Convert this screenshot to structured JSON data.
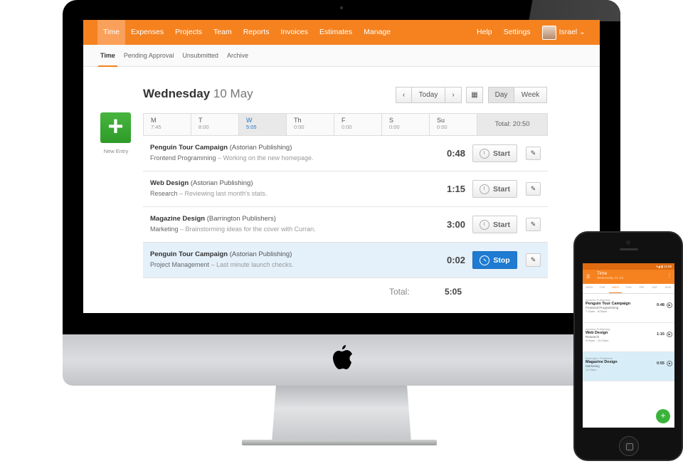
{
  "colors": {
    "brand": "#f5821f",
    "primary": "#1e7bd1",
    "success": "#3bb33a"
  },
  "topnav": {
    "items": [
      "Time",
      "Expenses",
      "Projects",
      "Team",
      "Reports",
      "Invoices",
      "Estimates",
      "Manage"
    ],
    "active": "Time",
    "help": "Help",
    "settings": "Settings",
    "user": "Israel ⌄"
  },
  "subnav": {
    "items": [
      "Time",
      "Pending Approval",
      "Unsubmitted",
      "Archive"
    ],
    "active": "Time"
  },
  "header": {
    "weekday": "Wednesday",
    "date": "10 May"
  },
  "controls": {
    "prev": "‹",
    "today": "Today",
    "next": "›",
    "calendar_icon": "▦",
    "day": "Day",
    "week": "Week"
  },
  "new_entry": {
    "icon": "+",
    "label": "New Entry"
  },
  "week": {
    "days": [
      {
        "label": "M",
        "hours": "7:45"
      },
      {
        "label": "T",
        "hours": "8:00"
      },
      {
        "label": "W",
        "hours": "5:05"
      },
      {
        "label": "Th",
        "hours": "0:00"
      },
      {
        "label": "F",
        "hours": "0:00"
      },
      {
        "label": "S",
        "hours": "0:00"
      },
      {
        "label": "Su",
        "hours": "0:00"
      }
    ],
    "total": "Total: 20:50"
  },
  "entries": [
    {
      "project": "Penguin Tour Campaign",
      "client": "(Astorian Publishing)",
      "task": "Frontend Programming",
      "note": "–  Working on the new homepage.",
      "duration": "0:48",
      "action": "Start"
    },
    {
      "project": "Web Design",
      "client": "(Astorian Publishing)",
      "task": "Research",
      "note": "–  Reviewing last month's stats.",
      "duration": "1:15",
      "action": "Start"
    },
    {
      "project": "Magazine Design",
      "client": "(Barrington Publishers)",
      "task": "Marketing",
      "note": "–  Brainstorming ideas for the cover with Curran.",
      "duration": "3:00",
      "action": "Start"
    },
    {
      "project": "Penguin Tour Campaign",
      "client": "(Astorian Publishing)",
      "task": "Project Management",
      "note": "–  Last minute launch checks.",
      "duration": "0:02",
      "action": "Stop"
    }
  ],
  "total": {
    "label": "Total:",
    "value": "5:05"
  },
  "phone": {
    "status_time": "▾◢ ▮ 11:55",
    "title": "Time",
    "subtitle": "Wednesday 22 Jul",
    "days": [
      "MON",
      "TUE",
      "WED",
      "THU",
      "FRI",
      "SAT",
      "SUN"
    ],
    "active_day": "WED",
    "entries": [
      {
        "client": "Astorian Publishing",
        "project": "Penguin Tour Campaign",
        "task": "Frontend Programming",
        "hours": "7:15am - 8:05am",
        "duration": "0:48"
      },
      {
        "client": "Astorian Publishing",
        "project": "Web Design",
        "task": "Research",
        "hours": "9:00am - 10:15am",
        "duration": "1:15"
      },
      {
        "client": "Barrington Publishers",
        "project": "Magazine Design",
        "task": "Marketing",
        "hours": "10:15am",
        "duration": "0:55"
      }
    ],
    "fab": "+"
  }
}
